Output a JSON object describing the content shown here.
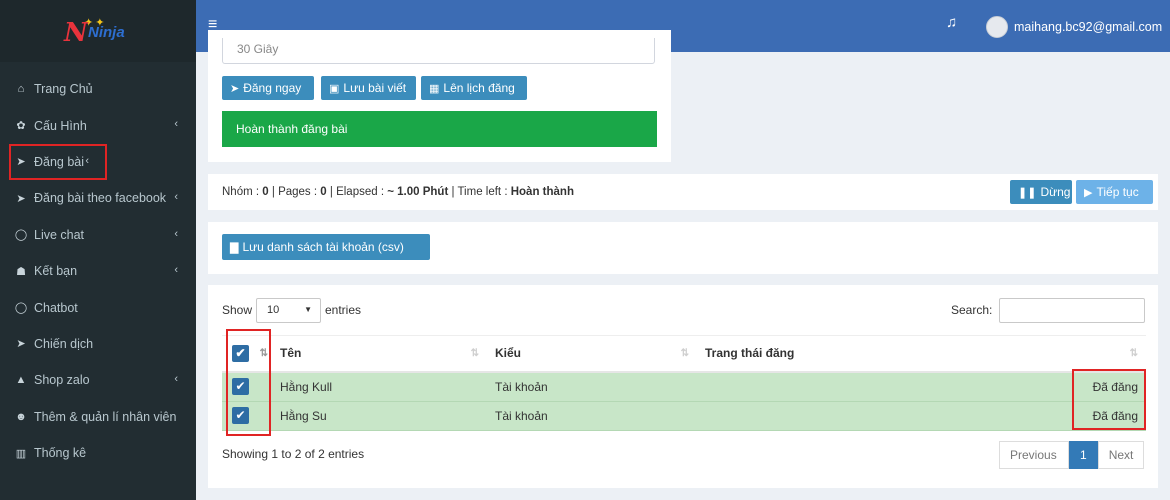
{
  "logo": {
    "text": "Ninja"
  },
  "sidebar": {
    "items": [
      {
        "label": "Trang Chủ",
        "icon": "home-icon",
        "glyph": "⌂",
        "has_chevron": false
      },
      {
        "label": "Cấu Hình",
        "icon": "gear-icon",
        "glyph": "✿",
        "has_chevron": true
      },
      {
        "label": "Đăng bài",
        "icon": "send-icon",
        "glyph": "➤",
        "has_chevron": true,
        "highlighted": true
      },
      {
        "label": "Đăng bài theo facebook",
        "icon": "send-icon",
        "glyph": "➤",
        "has_chevron": true
      },
      {
        "label": "Live chat",
        "icon": "chat-icon",
        "glyph": "◯",
        "has_chevron": true
      },
      {
        "label": "Kết bạn",
        "icon": "users-icon",
        "glyph": "☗",
        "has_chevron": true
      },
      {
        "label": "Chatbot",
        "icon": "chat-icon",
        "glyph": "◯",
        "has_chevron": false
      },
      {
        "label": "Chiến dịch",
        "icon": "send-icon",
        "glyph": "➤",
        "has_chevron": false
      },
      {
        "label": "Shop zalo",
        "icon": "shop-icon",
        "glyph": "▲",
        "has_chevron": true
      },
      {
        "label": "Thêm & quản lí nhân viên",
        "icon": "user-plus-icon",
        "glyph": "☻",
        "has_chevron": false
      },
      {
        "label": "Thống kê",
        "icon": "bar-chart-icon",
        "glyph": "▥",
        "has_chevron": false
      }
    ],
    "chevron": "‹"
  },
  "topbar": {
    "menu_icon": "≡",
    "bell_icon": "🔔",
    "email": "maihang.bc92@gmail.com"
  },
  "post_panel": {
    "prev_field_value": "30 Giây",
    "post_now": "Đăng ngay",
    "save_post": "Lưu bài viết",
    "schedule": "Lên lịch đăng",
    "done_message": "Hoàn thành đăng bài"
  },
  "status_bar": {
    "group_label": "Nhóm :",
    "group_value": "0",
    "pages_label": "| Pages :",
    "pages_value": "0",
    "elapsed_label": "| Elapsed :",
    "elapsed_value": "~ 1.00 Phút",
    "timeleft_label": "| Time left :",
    "timeleft_value": "Hoàn thành",
    "stop": "Dừng",
    "continue": "Tiếp tục"
  },
  "csv_button": "Lưu danh sách tài khoản (csv)",
  "table": {
    "show_label": "Show",
    "page_length": "10",
    "entries_label": "entries",
    "search_label": "Search:",
    "columns": [
      "Tên",
      "Kiểu",
      "Trang thái đăng"
    ],
    "rows": [
      {
        "checked": true,
        "name": "Hằng Kull",
        "type": "Tài khoản",
        "status": "Đã đăng"
      },
      {
        "checked": true,
        "name": "Hằng Su",
        "type": "Tài khoản",
        "status": "Đã đăng"
      }
    ],
    "info": "Showing 1 to 2 of 2 entries",
    "pager": {
      "previous": "Previous",
      "current": "1",
      "next": "Next"
    }
  }
}
